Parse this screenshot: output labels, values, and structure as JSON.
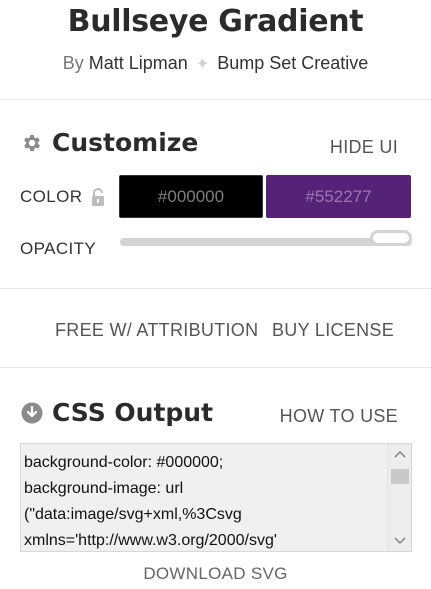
{
  "header": {
    "title": "Bullseye Gradient",
    "by_prefix": "By",
    "author": "Matt Lipman",
    "separator_icon": "sparkle-icon",
    "company": "Bump Set Creative"
  },
  "customize": {
    "heading": "Customize",
    "heading_icon": "gear-icon",
    "hide_ui_label": "HIDE UI",
    "color_label": "COLOR",
    "lock_icon": "unlock-icon",
    "color_1": "#000000",
    "color_2": "#552277",
    "opacity_label": "OPACITY",
    "opacity_value": 1.0
  },
  "license": {
    "free_label": "FREE W/ ATTRIBUTION",
    "buy_label": "BUY LICENSE"
  },
  "output": {
    "heading": "CSS Output",
    "heading_icon": "download-circle-icon",
    "how_to_label": "HOW TO USE",
    "code_lines": [
      "background-color: #000000;",
      "background-image: url",
      "(\"data:image/svg+xml,%3Csvg",
      "xmlns='http://www.w3.org/2000/svg'"
    ],
    "download_label": "DOWNLOAD SVG"
  },
  "colors": {
    "accent_purple": "#552277",
    "black": "#000000"
  }
}
